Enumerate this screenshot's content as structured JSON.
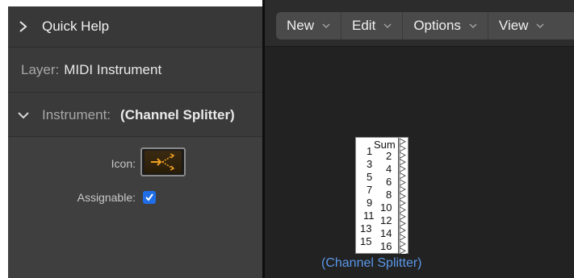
{
  "inspector": {
    "quick_help": "Quick Help",
    "layer_label": "Layer:",
    "layer_value": "MIDI Instrument",
    "instrument_label": "Instrument:",
    "instrument_value": "(Channel Splitter)",
    "icon_label": "Icon:",
    "assignable_label": "Assignable:",
    "assignable_checked": true
  },
  "toolbar": {
    "menus": [
      "New",
      "Edit",
      "Options",
      "View"
    ]
  },
  "splitter": {
    "sum_label": "Sum",
    "left_numbers": [
      "1",
      "3",
      "5",
      "7",
      "9",
      "11",
      "13",
      "15"
    ],
    "right_numbers": [
      "2",
      "4",
      "6",
      "8",
      "10",
      "12",
      "14",
      "16"
    ],
    "name": "(Channel Splitter)"
  },
  "colors": {
    "accent": "#1f6ee8",
    "object_name": "#5a97e8",
    "icon_orange": "#f0a020"
  }
}
